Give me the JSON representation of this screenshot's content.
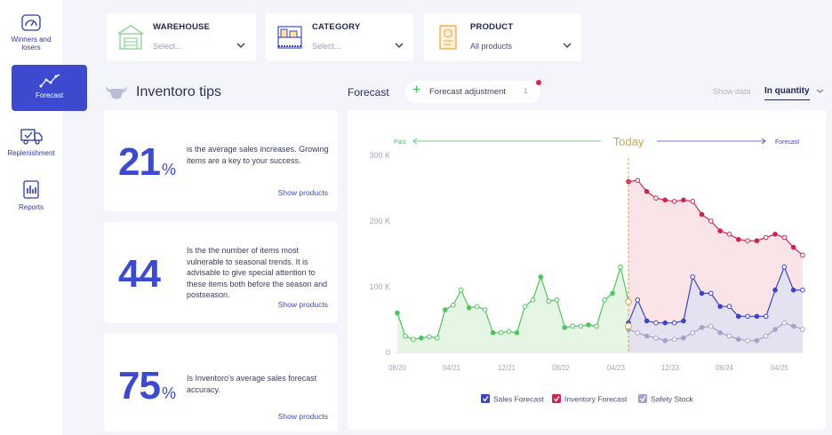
{
  "sidebar": {
    "items": [
      {
        "label": "Winners and losers",
        "icon": "speedometer-icon"
      },
      {
        "label": "Forecast",
        "icon": "trend-line-icon",
        "active": true
      },
      {
        "label": "Replenishment",
        "icon": "truck-icon"
      },
      {
        "label": "Reports",
        "icon": "report-icon"
      }
    ]
  },
  "filters": {
    "warehouse": {
      "label": "WAREHOUSE",
      "value": "Select...",
      "icon": "warehouse-icon"
    },
    "category": {
      "label": "CATEGORY",
      "value": "Select...",
      "icon": "shelves-icon"
    },
    "product": {
      "label": "PRODUCT",
      "value": "All products",
      "icon": "product-box-icon"
    }
  },
  "tips": {
    "title": "Inventoro tips",
    "icon": "bull-icon",
    "cards": [
      {
        "number": "21",
        "unit": "%",
        "text": "is the average sales increases. Growing items are a key to your success.",
        "link": "Show products"
      },
      {
        "number": "44",
        "unit": "",
        "text": "Is the the number of items most vulnerable to seasonal trends. It is advisable to give special attention to these items both before the season and postseason.",
        "link": "Show products"
      },
      {
        "number": "75",
        "unit": "%",
        "text": "Is Inventoro's average sales forecast accuracy.",
        "link": "Show products"
      }
    ]
  },
  "forecast_header": {
    "title": "Forecast",
    "adjustment_label": "Forecast adjustment",
    "adjustment_count": "1",
    "show_data_label": "Show data",
    "show_data_value": "In quantity"
  },
  "chart_data": {
    "type": "line",
    "timeline": {
      "past_label": "Past",
      "today_label": "Today",
      "forecast_label": "Forecast"
    },
    "x_ticks": [
      "08/20",
      "04/21",
      "12/21",
      "08/22",
      "04/23",
      "12/23",
      "08/24",
      "04/25"
    ],
    "y_ticks": [
      "0",
      "100  K",
      "200  K",
      "300  K"
    ],
    "ylim": [
      0,
      300000
    ],
    "colors": {
      "sales": "#4fc35e",
      "sales_fill": "#e6f6e5",
      "forecast": "#3d43c9",
      "inventory": "#cf2350",
      "inventory_fill": "#fbe4e8",
      "safety": "#a6a2c6",
      "safety_fill": "#e4e1f1",
      "today": "#c9a74a"
    },
    "sales_history": [
      60000,
      25000,
      20000,
      22000,
      24000,
      22000,
      65000,
      72000,
      95000,
      68000,
      70000,
      65000,
      30000,
      30000,
      32000,
      30000,
      70000,
      80000,
      115000,
      78000,
      80000,
      38000,
      40000,
      40000,
      42000,
      40000,
      80000,
      90000,
      130000,
      78000
    ],
    "series": [
      {
        "name": "Sales Forecast",
        "values": [
          45000,
          80000,
          48000,
          45000,
          45000,
          45000,
          48000,
          115000,
          90000,
          90000,
          70000,
          70000,
          55000,
          55000,
          55000,
          55000,
          95000,
          130000,
          95000,
          95000
        ]
      },
      {
        "name": "Inventory Forecast",
        "values": [
          260000,
          262000,
          245000,
          235000,
          232000,
          230000,
          232000,
          230000,
          210000,
          200000,
          185000,
          180000,
          172000,
          170000,
          170000,
          175000,
          180000,
          175000,
          160000,
          148000
        ]
      },
      {
        "name": "Safety Stock",
        "values": [
          35000,
          30000,
          25000,
          22000,
          18000,
          20000,
          22000,
          30000,
          38000,
          40000,
          30000,
          25000,
          20000,
          18000,
          18000,
          25000,
          35000,
          45000,
          40000,
          35000
        ]
      }
    ]
  }
}
